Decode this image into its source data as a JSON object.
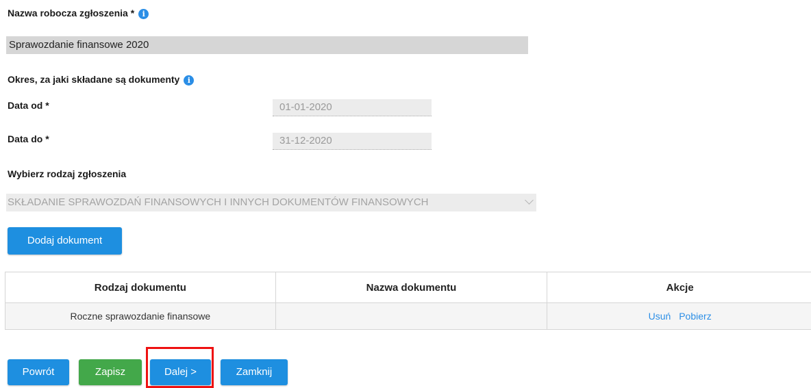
{
  "form": {
    "draft_name_label": "Nazwa robocza zgłoszenia *",
    "draft_name_value": "Sprawozdanie finansowe 2020",
    "period_label": "Okres, za jaki składane są dokumenty",
    "date_from_label": "Data od *",
    "date_from_value": "01-01-2020",
    "date_to_label": "Data do *",
    "date_to_value": "31-12-2020",
    "type_label": "Wybierz rodzaj zgłoszenia",
    "type_value": "SKŁADANIE SPRAWOZDAŃ FINANSOWYCH I INNYCH DOKUMENTÓW FINANSOWYCH",
    "add_document_label": "Dodaj dokument"
  },
  "table": {
    "headers": [
      "Rodzaj dokumentu",
      "Nazwa dokumentu",
      "Akcje"
    ],
    "rows": [
      {
        "type": "Roczne sprawozdanie finansowe",
        "name": "",
        "action_delete": "Usuń",
        "action_download": "Pobierz"
      }
    ]
  },
  "footer": {
    "back_label": "Powrót",
    "save_label": "Zapisz",
    "next_label": "Dalej >",
    "close_label": "Zamknij"
  },
  "icons": {
    "info": "info-icon"
  },
  "colors": {
    "primary": "#1e8fe0",
    "success": "#43a84a",
    "highlight": "#ee1111",
    "link": "#2b8ee6"
  }
}
